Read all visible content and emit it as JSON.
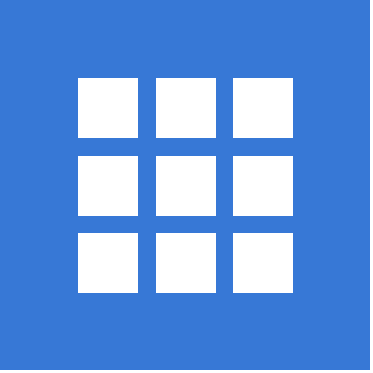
{
  "app_icon": {
    "icon": "grid-icon",
    "background_color": "#3778d6",
    "cell_color": "#ffffff",
    "rows": 3,
    "columns": 3
  }
}
